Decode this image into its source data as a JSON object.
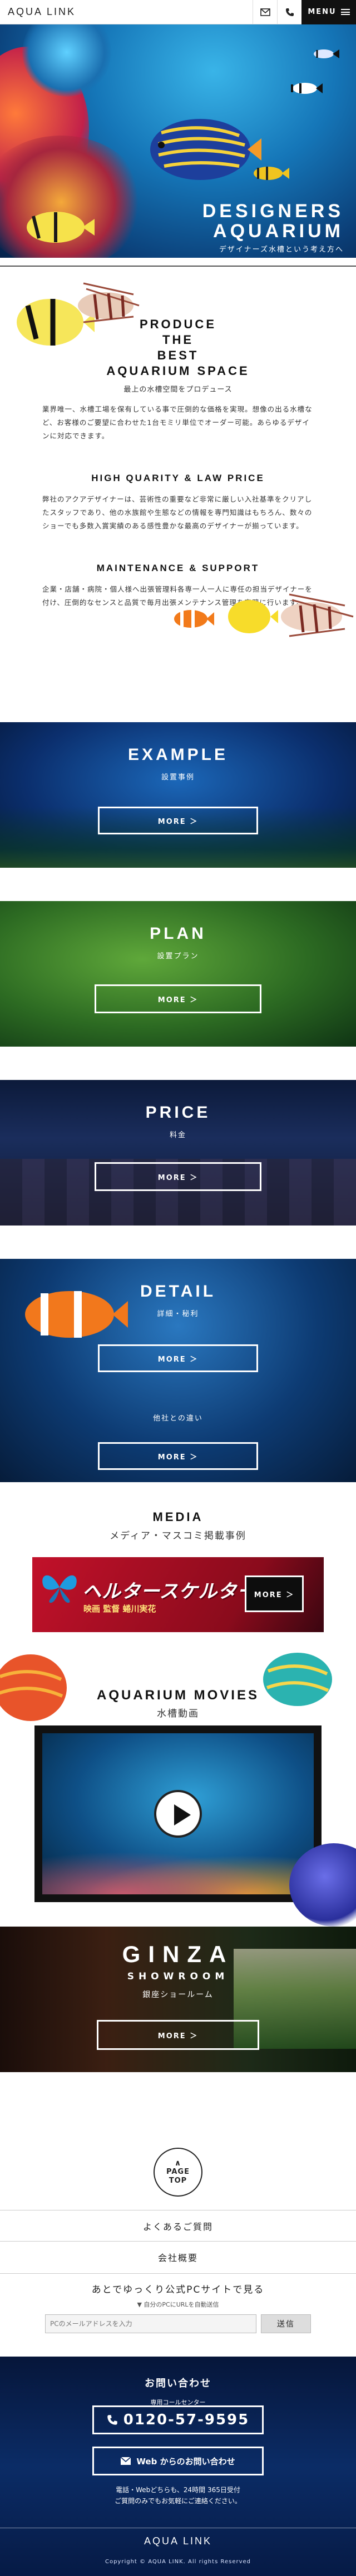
{
  "header": {
    "logo": "AQUA LINK",
    "menu_label": "MENU"
  },
  "hero": {
    "title_line1": "DESIGNERS",
    "title_line2": "AQUARIUM",
    "subtitle": "デザイナーズ水槽という考え方へ"
  },
  "intro": {
    "heading_lines": [
      "PRODUCE",
      "THE",
      "BEST",
      "AQUARIUM SPACE"
    ],
    "sub": "最上の水槽空間をプロデュース",
    "para1": "業界唯一、水槽工場を保有している事で圧倒的な価格を実現。想像の出る水槽など、お客様のご要望に合わせた1台モミリ単位でオーダー可能。あらゆるデザインに対応できます。",
    "h2": "HIGH QUARITY & LAW PRICE",
    "para2": "弊社のアクアデザイナーは、芸術性の重要など非常に厳しい入社基準をクリアしたスタッフであり、他の水族館や生態などの情報を専門知識はもちろん、数々のショーでも多数入賞実績のある感性豊かな最高のデザイナーが揃っています。",
    "h3": "MAINTENANCE & SUPPORT",
    "para3": "企業・店舗・病院・個人様へ出張管理料各専一人一人に専任の担当デザイナーを付け、圧倒的なセンスと品質で毎月出張メンテナンス管理を完璧に行います。"
  },
  "example": {
    "title": "EXAMPLE",
    "jp": "設置事例",
    "more": "MORE ＞"
  },
  "plan": {
    "title": "PLAN",
    "jp": "設置プラン",
    "more": "MORE ＞"
  },
  "price": {
    "title": "PRICE",
    "jp": "料金",
    "more": "MORE ＞"
  },
  "detail": {
    "title": "DETAIL",
    "jp": "詳細・秘利",
    "more": "MORE ＞",
    "jp2": "他社との違い",
    "more2": "MORE ＞"
  },
  "media": {
    "title": "MEDIA",
    "jp": "メディア・マスコミ掲載事例",
    "banner_title": "ヘルタースケルター",
    "banner_sub": "映画 監督 蜷川実花",
    "banner_more": "MORE ＞"
  },
  "movies": {
    "title": "AQUARIUM MOVIES",
    "jp": "水槽動画"
  },
  "ginza": {
    "title": "GINZA",
    "sub": "SHOWROOM",
    "jp": "銀座ショールーム",
    "more": "MORE ＞"
  },
  "footer": {
    "pagetop_line1": "PAGE",
    "pagetop_line2": "TOP",
    "faq": "よくあるご質問",
    "company": "会社概要",
    "pc_heading": "あとでゆっくり公式PCサイトで見る",
    "pc_sub": "▼ 自分のPCにURLを自動送信",
    "pc_placeholder": "PCのメールアドレスを入力",
    "send": "送信",
    "contact_heading": "お問い合わせ",
    "contact_sub": "専用コールセンター",
    "tel": "0120-57-9595",
    "web_label": "Web からのお問い合わせ",
    "note_line1": "電話・Webどちらも、24時間 365日受付",
    "note_line2": "ご質問のみでもお気軽にご連絡ください。",
    "brand": "AQUA LINK",
    "copyright": "Copyright © AQUA LINK. All rights Reserved"
  }
}
